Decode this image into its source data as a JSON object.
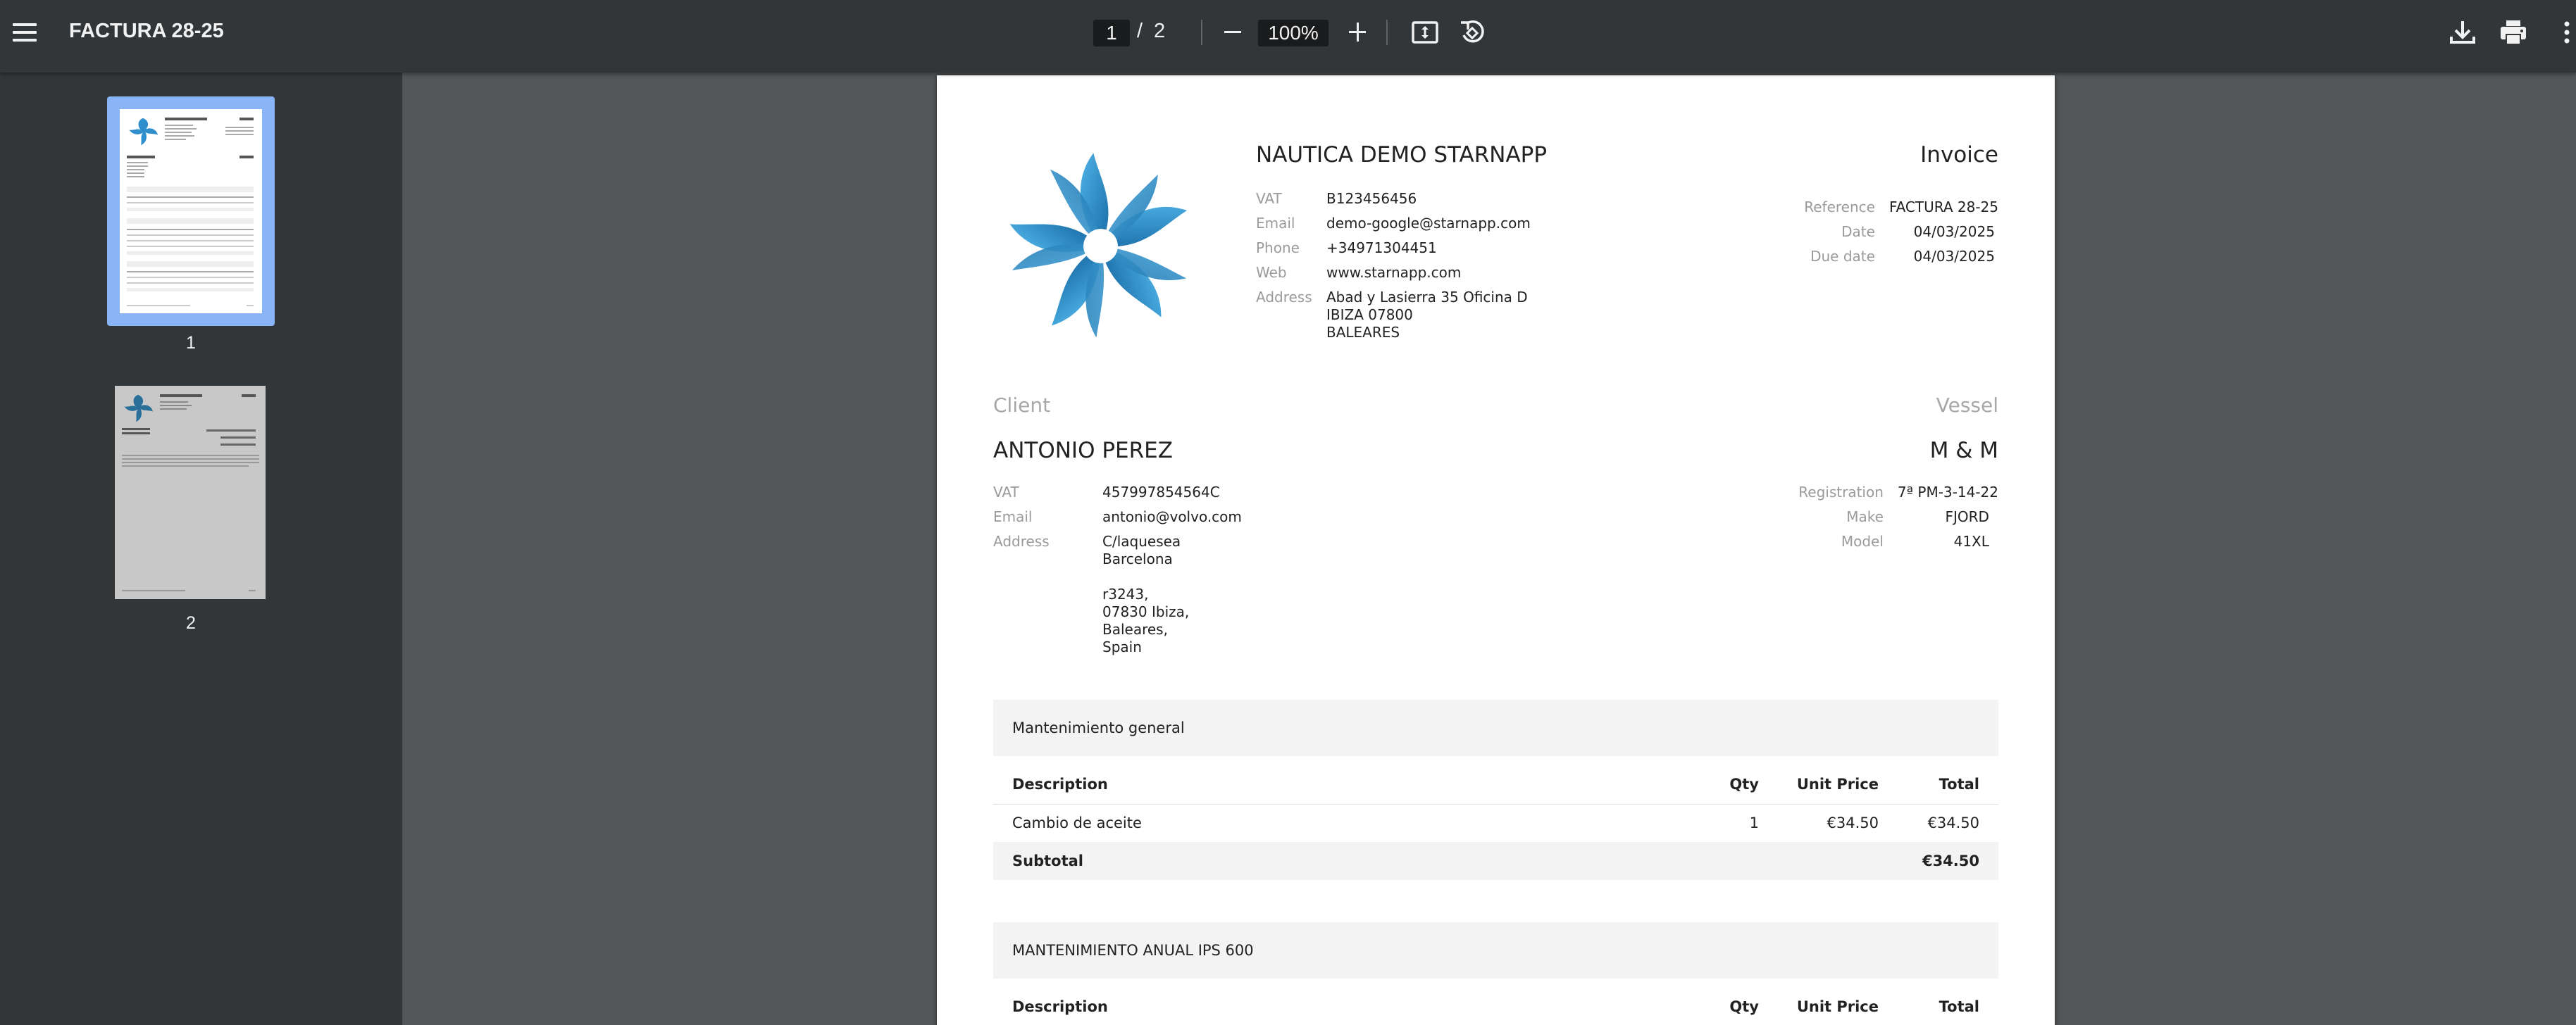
{
  "toolbar": {
    "title": "FACTURA 28-25",
    "page_current": "1",
    "page_separator": "/",
    "page_total": "2",
    "zoom": "100%"
  },
  "sidebar": {
    "thumbnails": [
      {
        "label": "1",
        "selected": true
      },
      {
        "label": "2",
        "selected": false
      }
    ]
  },
  "invoice": {
    "company": {
      "name": "NAUTICA DEMO STARNAPP",
      "fields": [
        {
          "label": "VAT",
          "value": "B123456456"
        },
        {
          "label": "Email",
          "value": "demo-google@starnapp.com"
        },
        {
          "label": "Phone",
          "value": "+34971304451"
        },
        {
          "label": "Web",
          "value": "www.starnapp.com"
        }
      ],
      "address_label": "Address",
      "address_lines": [
        "Abad y Lasierra 35 Oficina D",
        "IBIZA 07800",
        "BALEARES"
      ]
    },
    "title": "Invoice",
    "meta": [
      {
        "label": "Reference",
        "value": "FACTURA 28-25"
      },
      {
        "label": "Date",
        "value": "04/03/2025"
      },
      {
        "label": "Due date",
        "value": "04/03/2025"
      }
    ],
    "client": {
      "heading": "Client",
      "name": "ANTONIO PEREZ",
      "fields": [
        {
          "label": "VAT",
          "value": "457997854564C"
        },
        {
          "label": "Email",
          "value": "antonio@volvo.com"
        }
      ],
      "address_label": "Address",
      "address_lines": [
        "C/laquesea",
        "Barcelona",
        "",
        "r3243,",
        "07830 Ibiza,",
        "Baleares,",
        "Spain"
      ]
    },
    "vessel": {
      "heading": "Vessel",
      "name": "M & M",
      "fields": [
        {
          "label": "Registration",
          "value": "7ª PM-3-14-22"
        },
        {
          "label": "Make",
          "value": "FJORD"
        },
        {
          "label": "Model",
          "value": "41XL"
        }
      ]
    },
    "columns": {
      "description": "Description",
      "qty": "Qty",
      "unit_price": "Unit Price",
      "total": "Total"
    },
    "groups": [
      {
        "title": "Mantenimiento general",
        "items": [
          {
            "description": "Cambio de aceite",
            "qty": "1",
            "unit_price": "€34.50",
            "total": "€34.50"
          }
        ],
        "subtotal_label": "Subtotal",
        "subtotal": "€34.50"
      },
      {
        "title": "MANTENIMIENTO ANUAL IPS 600",
        "items": []
      }
    ]
  },
  "colors": {
    "toolbar_bg": "#323639",
    "viewer_bg": "#525659",
    "thumbnail_selected_border": "#8ab4f8",
    "logo_blue": "#2e8fcc"
  }
}
